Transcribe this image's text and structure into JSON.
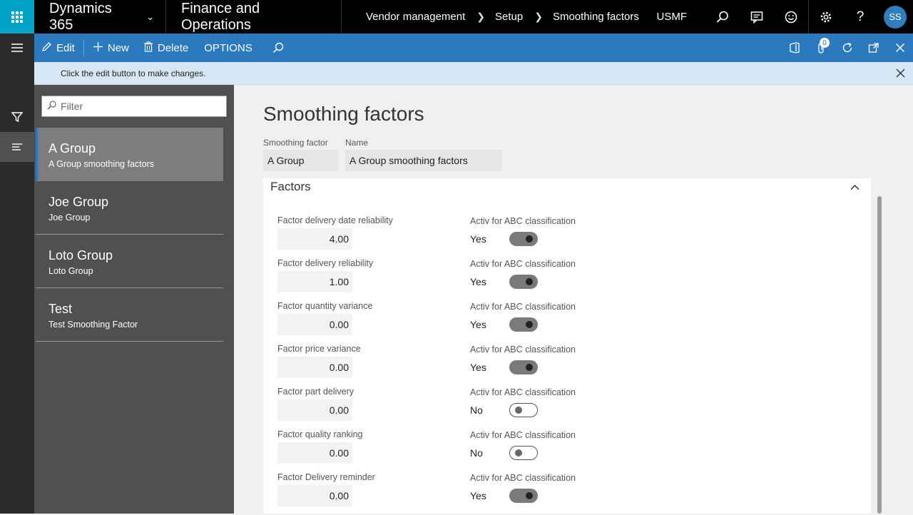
{
  "topbar": {
    "brand": "Dynamics 365",
    "app_name": "Finance and Operations",
    "breadcrumb": [
      "Vendor management",
      "Setup",
      "Smoothing factors"
    ],
    "company": "USMF",
    "avatar_initials": "SS"
  },
  "actionbar": {
    "edit_label": "Edit",
    "new_label": "New",
    "delete_label": "Delete",
    "options_label": "OPTIONS",
    "notification_count": "0"
  },
  "message": "Click the edit button to make changes.",
  "list": {
    "filter_placeholder": "Filter",
    "items": [
      {
        "title": "A Group",
        "subtitle": "A Group smoothing factors"
      },
      {
        "title": "Joe Group",
        "subtitle": "Joe Group"
      },
      {
        "title": "Loto Group",
        "subtitle": "Loto Group"
      },
      {
        "title": "Test",
        "subtitle": "Test Smoothing Factor"
      }
    ]
  },
  "details": {
    "page_title": "Smoothing factors",
    "smoothing_factor_label": "Smoothing factor",
    "smoothing_factor_value": "A Group",
    "name_label": "Name",
    "name_value": "A Group smoothing factors",
    "section_title": "Factors",
    "toggle_label": "Activ for ABC classification",
    "factors": [
      {
        "label": "Factor delivery date reliability",
        "value": "4.00",
        "active": "Yes"
      },
      {
        "label": "Factor delivery reliability",
        "value": "1.00",
        "active": "Yes"
      },
      {
        "label": "Factor quantity variance",
        "value": "0.00",
        "active": "Yes"
      },
      {
        "label": "Factor price variance",
        "value": "0.00",
        "active": "Yes"
      },
      {
        "label": "Factor part delivery",
        "value": "0.00",
        "active": "No"
      },
      {
        "label": "Factor quality ranking",
        "value": "0.00",
        "active": "No"
      },
      {
        "label": "Factor Delivery reminder",
        "value": "0.00",
        "active": "Yes"
      }
    ]
  },
  "colors": {
    "accent": "#2b79be",
    "waffle": "#00a4c4",
    "topbar": "#000000"
  }
}
